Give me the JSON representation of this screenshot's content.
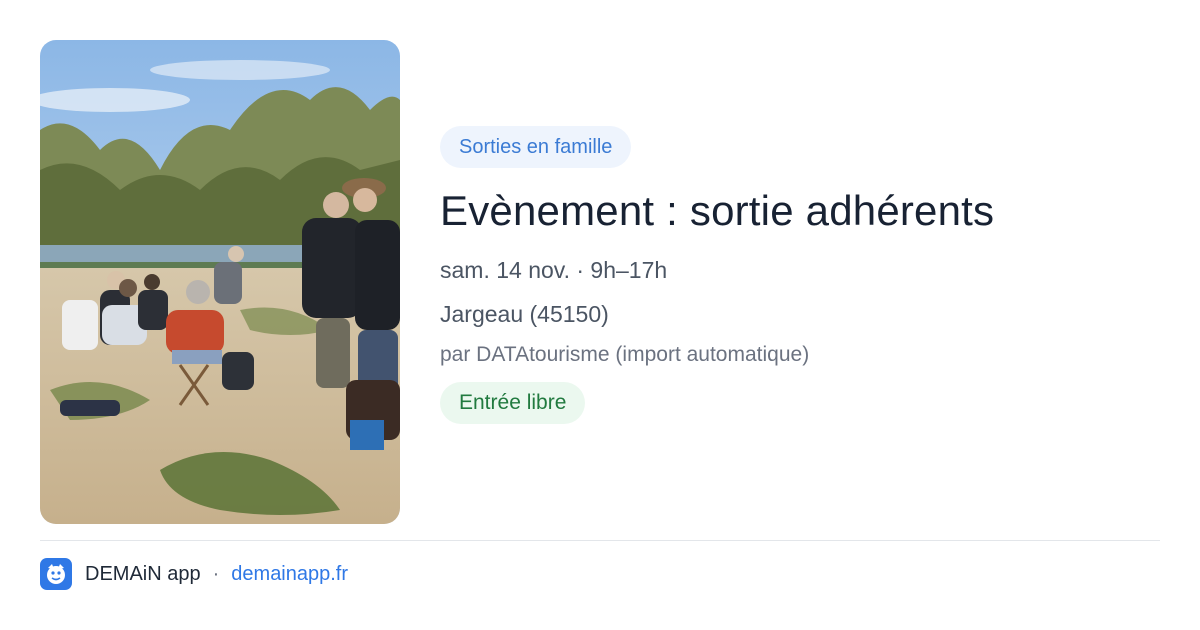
{
  "event": {
    "category": "Sorties en famille",
    "title": "Evènement : sortie adhérents",
    "date": "sam. 14 nov. · 9h–17h",
    "location": "Jargeau (45150)",
    "organizer": "par DATAtourisme (import automatique)",
    "price": "Entrée libre"
  },
  "footer": {
    "brand": "DEMAiN app",
    "separator": "·",
    "url": "demainapp.fr",
    "icon": "demain-logo-icon"
  },
  "colors": {
    "accent": "#2f78e6",
    "category_bg": "#eef4fd",
    "category_text": "#3b7bd4",
    "price_bg": "#ebf8ef",
    "price_text": "#217a3f",
    "title": "#182233"
  }
}
